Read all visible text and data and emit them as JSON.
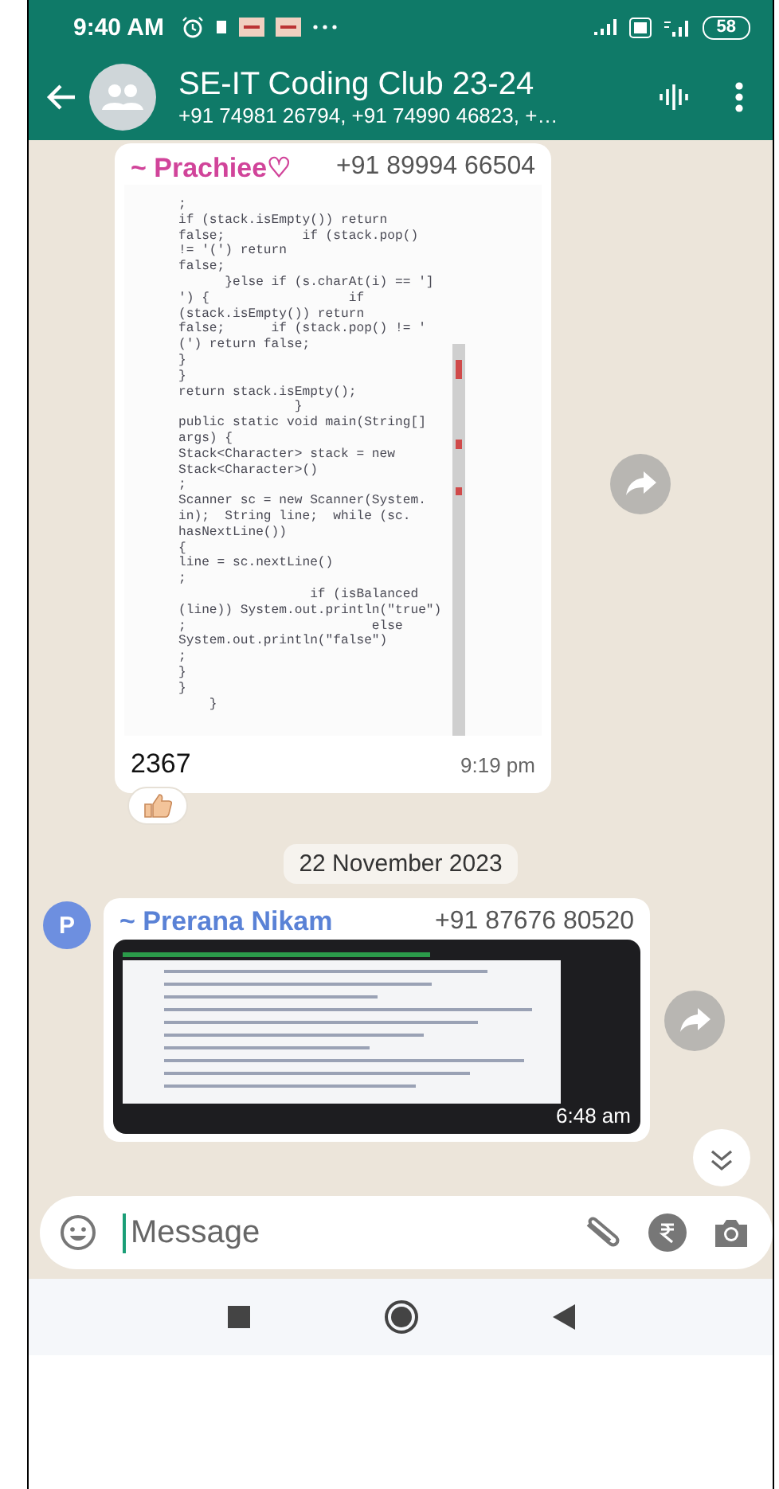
{
  "status_bar": {
    "time": "9:40 AM",
    "battery": "58"
  },
  "header": {
    "title": "SE-IT Coding Club 23-24",
    "subtitle": "+91 74981 26794, +91 74990 46823, +…"
  },
  "messages": [
    {
      "kind": "code_image",
      "sender": "~ Prachiee♡",
      "phone": "+91 89994 66504",
      "color": "#d1449a",
      "code_lines": [
        ";",
        "if (stack.isEmpty()) return",
        "false;          if (stack.pop()",
        "!= '(') return",
        "false;",
        "      }else if (s.charAt(i) == ']",
        "') {                  if",
        "(stack.isEmpty()) return",
        "false;      if (stack.pop() != '",
        "(') return false;",
        "}",
        "}",
        "return stack.isEmpty();",
        "               }",
        "public static void main(String[]",
        "args) {",
        "Stack<Character> stack = new",
        "Stack<Character>()",
        ";",
        "Scanner sc = new Scanner(System.",
        "in);  String line;  while (sc.",
        "hasNextLine())",
        "{",
        "line = sc.nextLine()",
        ";",
        "                 if (isBalanced",
        "(line)) System.out.println(\"true\")",
        ";                        else",
        "System.out.println(\"false\")",
        ";",
        "}",
        "}",
        "    }"
      ],
      "caption": "2367",
      "time": "9:19 pm",
      "reactions": [
        {
          "kind": "thumbs_up"
        }
      ]
    },
    {
      "kind": "date",
      "text": "22 November 2023"
    },
    {
      "kind": "screenshot",
      "sender": "~ Prerana Nikam",
      "phone": "+91 87676 80520",
      "color": "#5a82d6",
      "avatar": "P",
      "time": "6:48 am"
    }
  ],
  "composer": {
    "placeholder": "Message"
  }
}
